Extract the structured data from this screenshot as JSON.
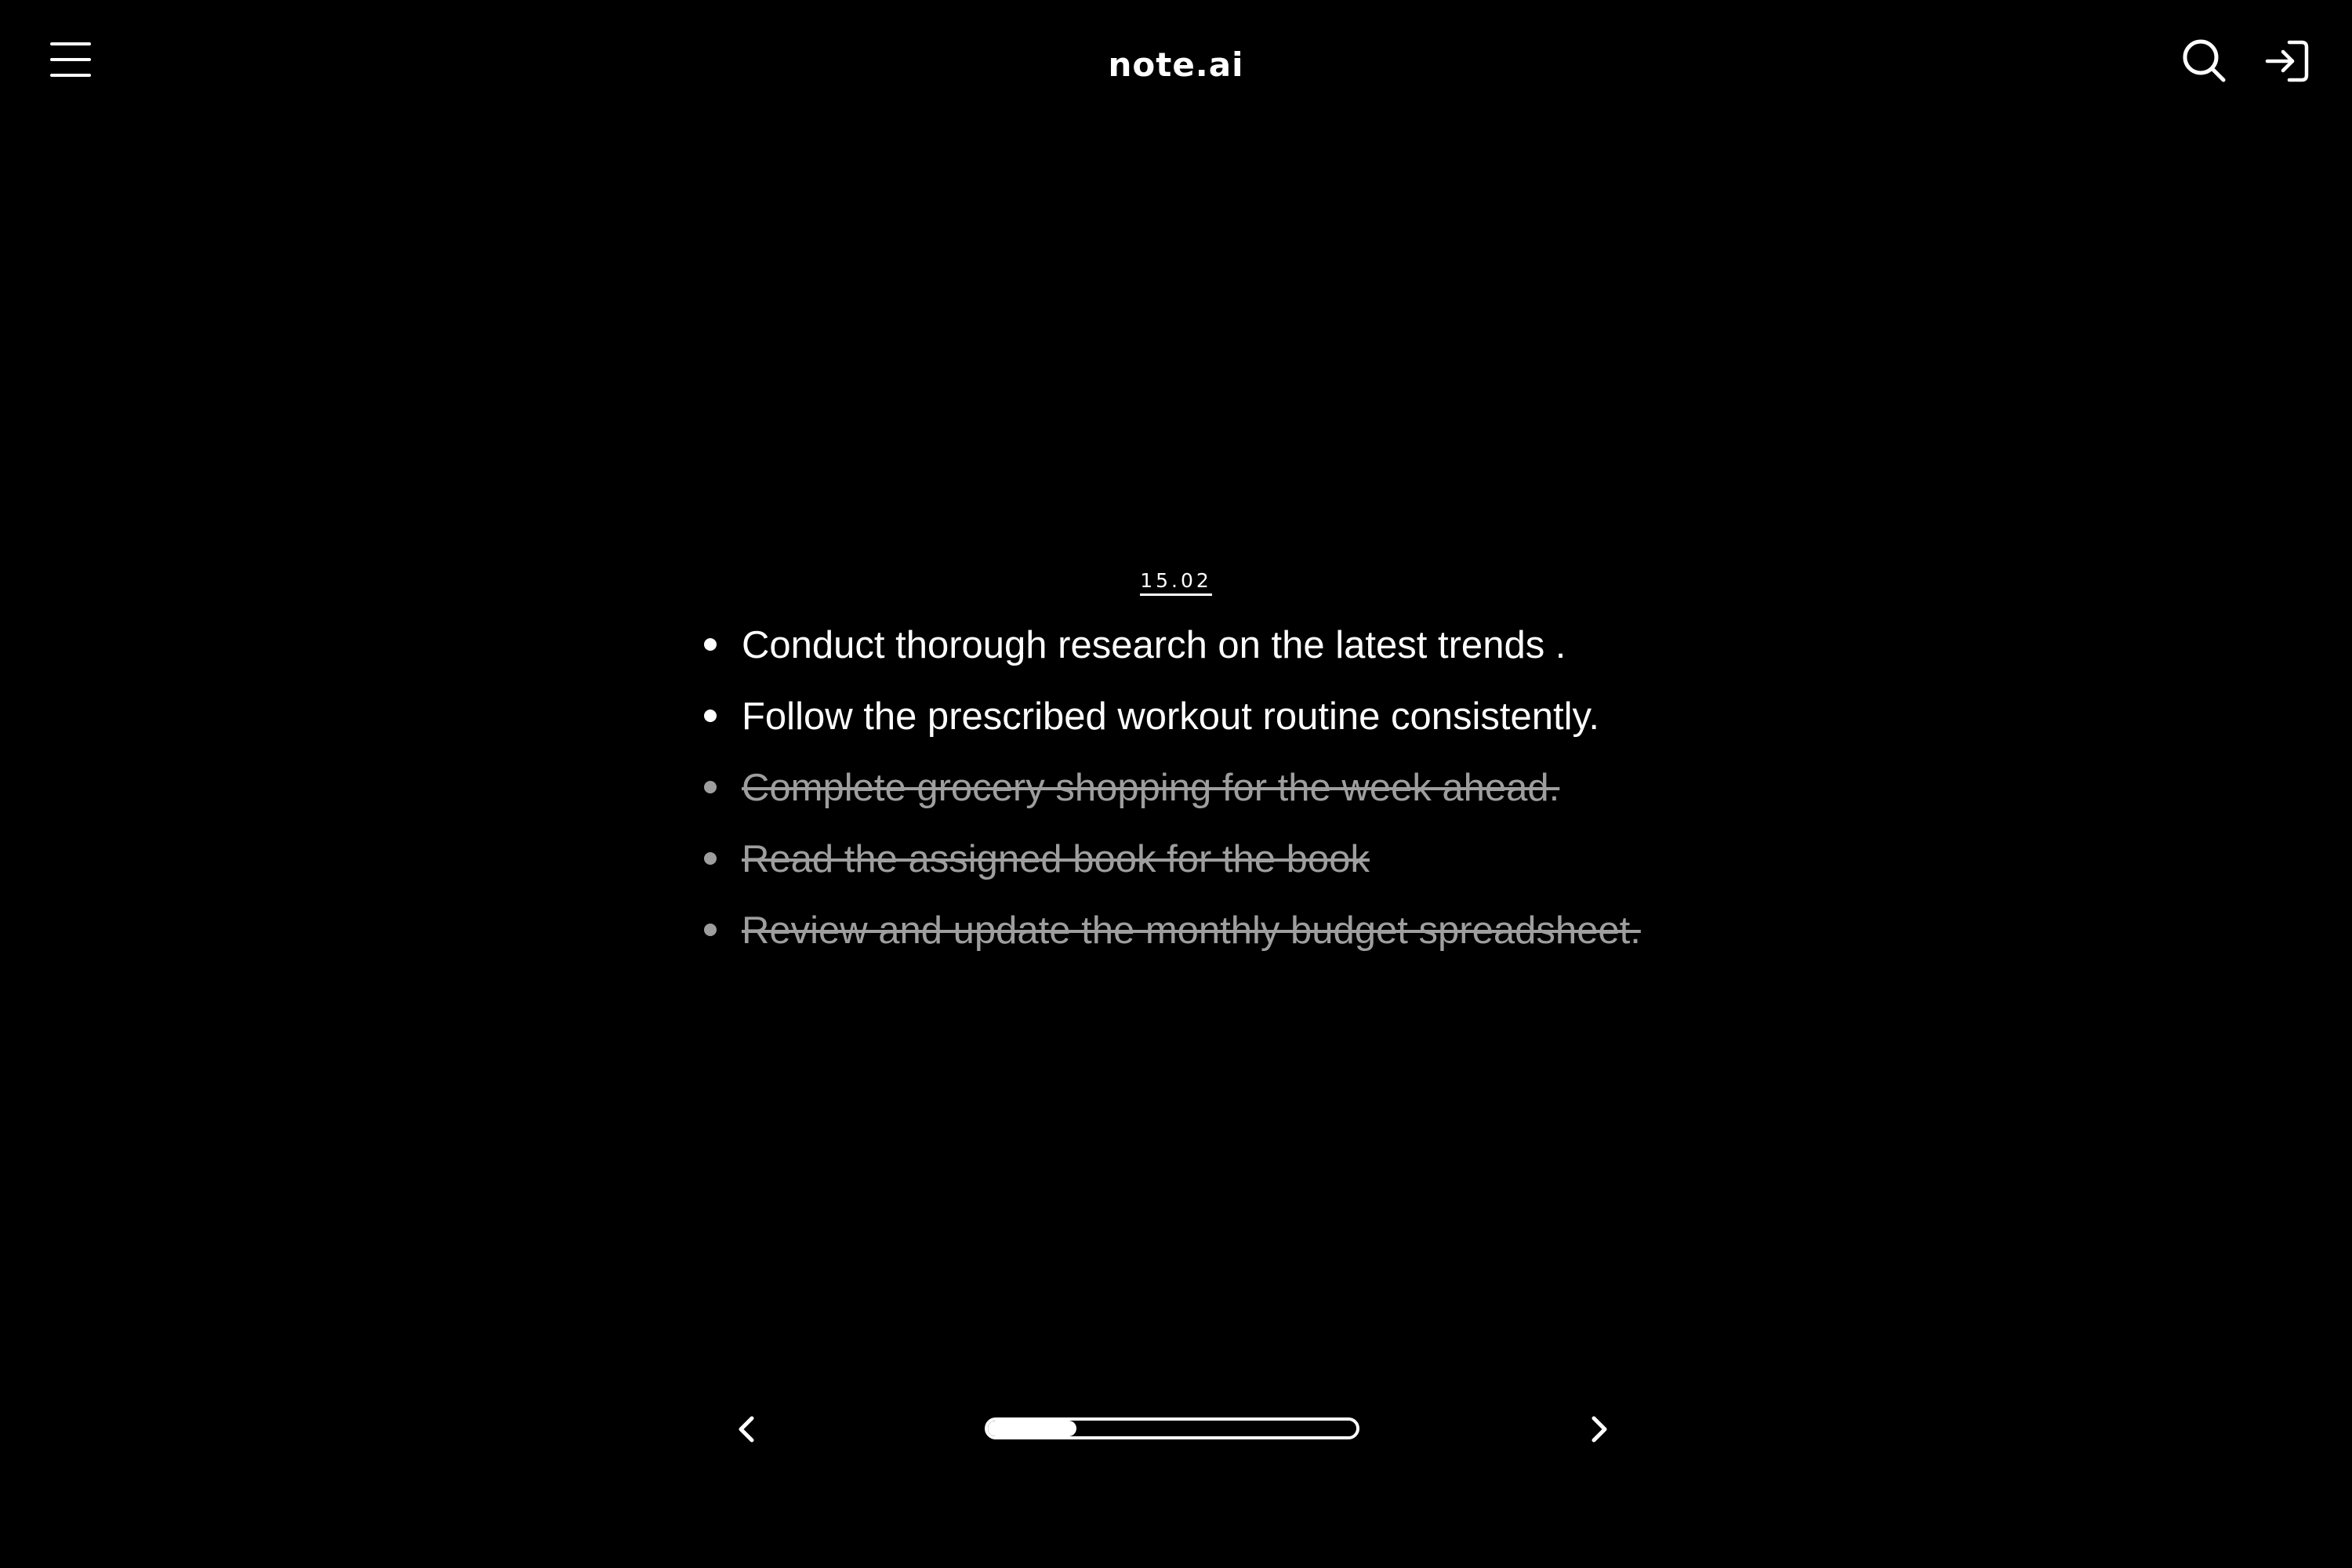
{
  "header": {
    "title": "note.ai",
    "menu_icon": "hamburger-menu-icon",
    "search_icon": "search-icon",
    "login_icon": "login-icon"
  },
  "note": {
    "date": "15.02",
    "tasks": [
      {
        "text": "Conduct thorough research on the latest trends .",
        "done": false
      },
      {
        "text": "Follow the prescribed workout routine consistently.",
        "done": false
      },
      {
        "text": "Complete grocery shopping for the week ahead. ",
        "done": true
      },
      {
        "text": "Read the assigned book for the book",
        "done": true
      },
      {
        "text": "Review and update the monthly budget spreadsheet. ",
        "done": true
      }
    ]
  },
  "pager": {
    "prev_icon": "chevron-left-icon",
    "next_icon": "chevron-right-icon",
    "progress_fraction": 0.24
  },
  "colors": {
    "background": "#000000",
    "text": "#ffffff",
    "done_text": "#9e9e9e"
  }
}
